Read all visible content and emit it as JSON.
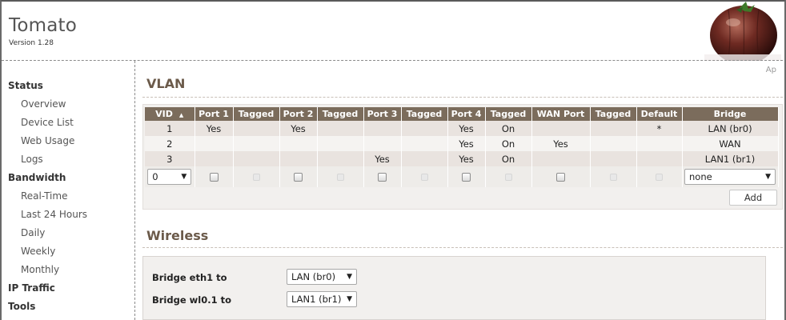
{
  "header": {
    "title": "Tomato",
    "version": "Version 1.28",
    "apply_hint": "Ap"
  },
  "sidebar": {
    "items": [
      {
        "label": "Status",
        "type": "section"
      },
      {
        "label": "Overview",
        "type": "sub"
      },
      {
        "label": "Device List",
        "type": "sub"
      },
      {
        "label": "Web Usage",
        "type": "sub"
      },
      {
        "label": "Logs",
        "type": "sub"
      },
      {
        "label": "Bandwidth",
        "type": "section"
      },
      {
        "label": "Real-Time",
        "type": "sub"
      },
      {
        "label": "Last 24 Hours",
        "type": "sub"
      },
      {
        "label": "Daily",
        "type": "sub"
      },
      {
        "label": "Weekly",
        "type": "sub"
      },
      {
        "label": "Monthly",
        "type": "sub"
      },
      {
        "label": "IP Traffic",
        "type": "section"
      },
      {
        "label": "Tools",
        "type": "section"
      }
    ]
  },
  "vlan": {
    "title": "VLAN",
    "columns": [
      "VID",
      "Port 1",
      "Tagged",
      "Port 2",
      "Tagged",
      "Port 3",
      "Tagged",
      "Port 4",
      "Tagged",
      "WAN Port",
      "Tagged",
      "Default",
      "Bridge"
    ],
    "sort_indicator": "▲",
    "rows": [
      [
        "1",
        "Yes",
        "",
        "Yes",
        "",
        "",
        "",
        "Yes",
        "On",
        "",
        "",
        "*",
        "LAN (br0)"
      ],
      [
        "2",
        "",
        "",
        "",
        "",
        "",
        "",
        "Yes",
        "On",
        "Yes",
        "",
        "",
        "WAN"
      ],
      [
        "3",
        "",
        "",
        "",
        "",
        "Yes",
        "",
        "Yes",
        "On",
        "",
        "",
        "",
        "LAN1 (br1)"
      ]
    ],
    "new_row": {
      "vid_value": "0",
      "bridge_value": "none"
    },
    "add_label": "Add"
  },
  "wireless": {
    "title": "Wireless",
    "rows": [
      {
        "label": "Bridge eth1 to",
        "value": "LAN (br0)"
      },
      {
        "label": "Bridge wl0.1 to",
        "value": "LAN1 (br1)"
      }
    ]
  },
  "colors": {
    "table_header": "#7b6c5c",
    "section_title": "#6b5a4a",
    "row_odd": "#e9e3df",
    "row_even": "#f5f3f1"
  }
}
